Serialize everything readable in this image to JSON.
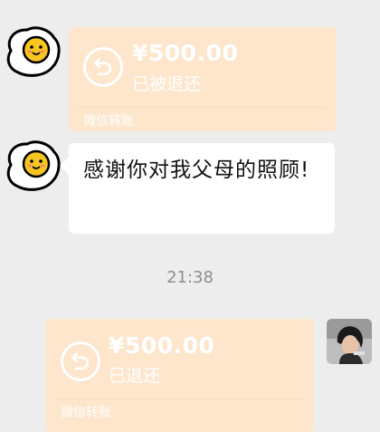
{
  "messages": [
    {
      "type": "transfer",
      "sender": "contact",
      "amount": "¥500.00",
      "status": "已被退还",
      "footer": "微信转账"
    },
    {
      "type": "text",
      "sender": "contact",
      "text": "感谢你对我父母的照顾!"
    },
    {
      "type": "timestamp",
      "text": "21:38"
    },
    {
      "type": "transfer",
      "sender": "self",
      "amount": "¥500.00",
      "status": "已退还",
      "footer": "微信转账"
    }
  ],
  "avatars": {
    "contact": "fried-egg-icon",
    "self": "user-photo"
  },
  "colors": {
    "background": "#ededed",
    "transfer_card": "#fde6cc",
    "text_bubble": "#ffffff",
    "timestamp": "#8e8e8e"
  }
}
